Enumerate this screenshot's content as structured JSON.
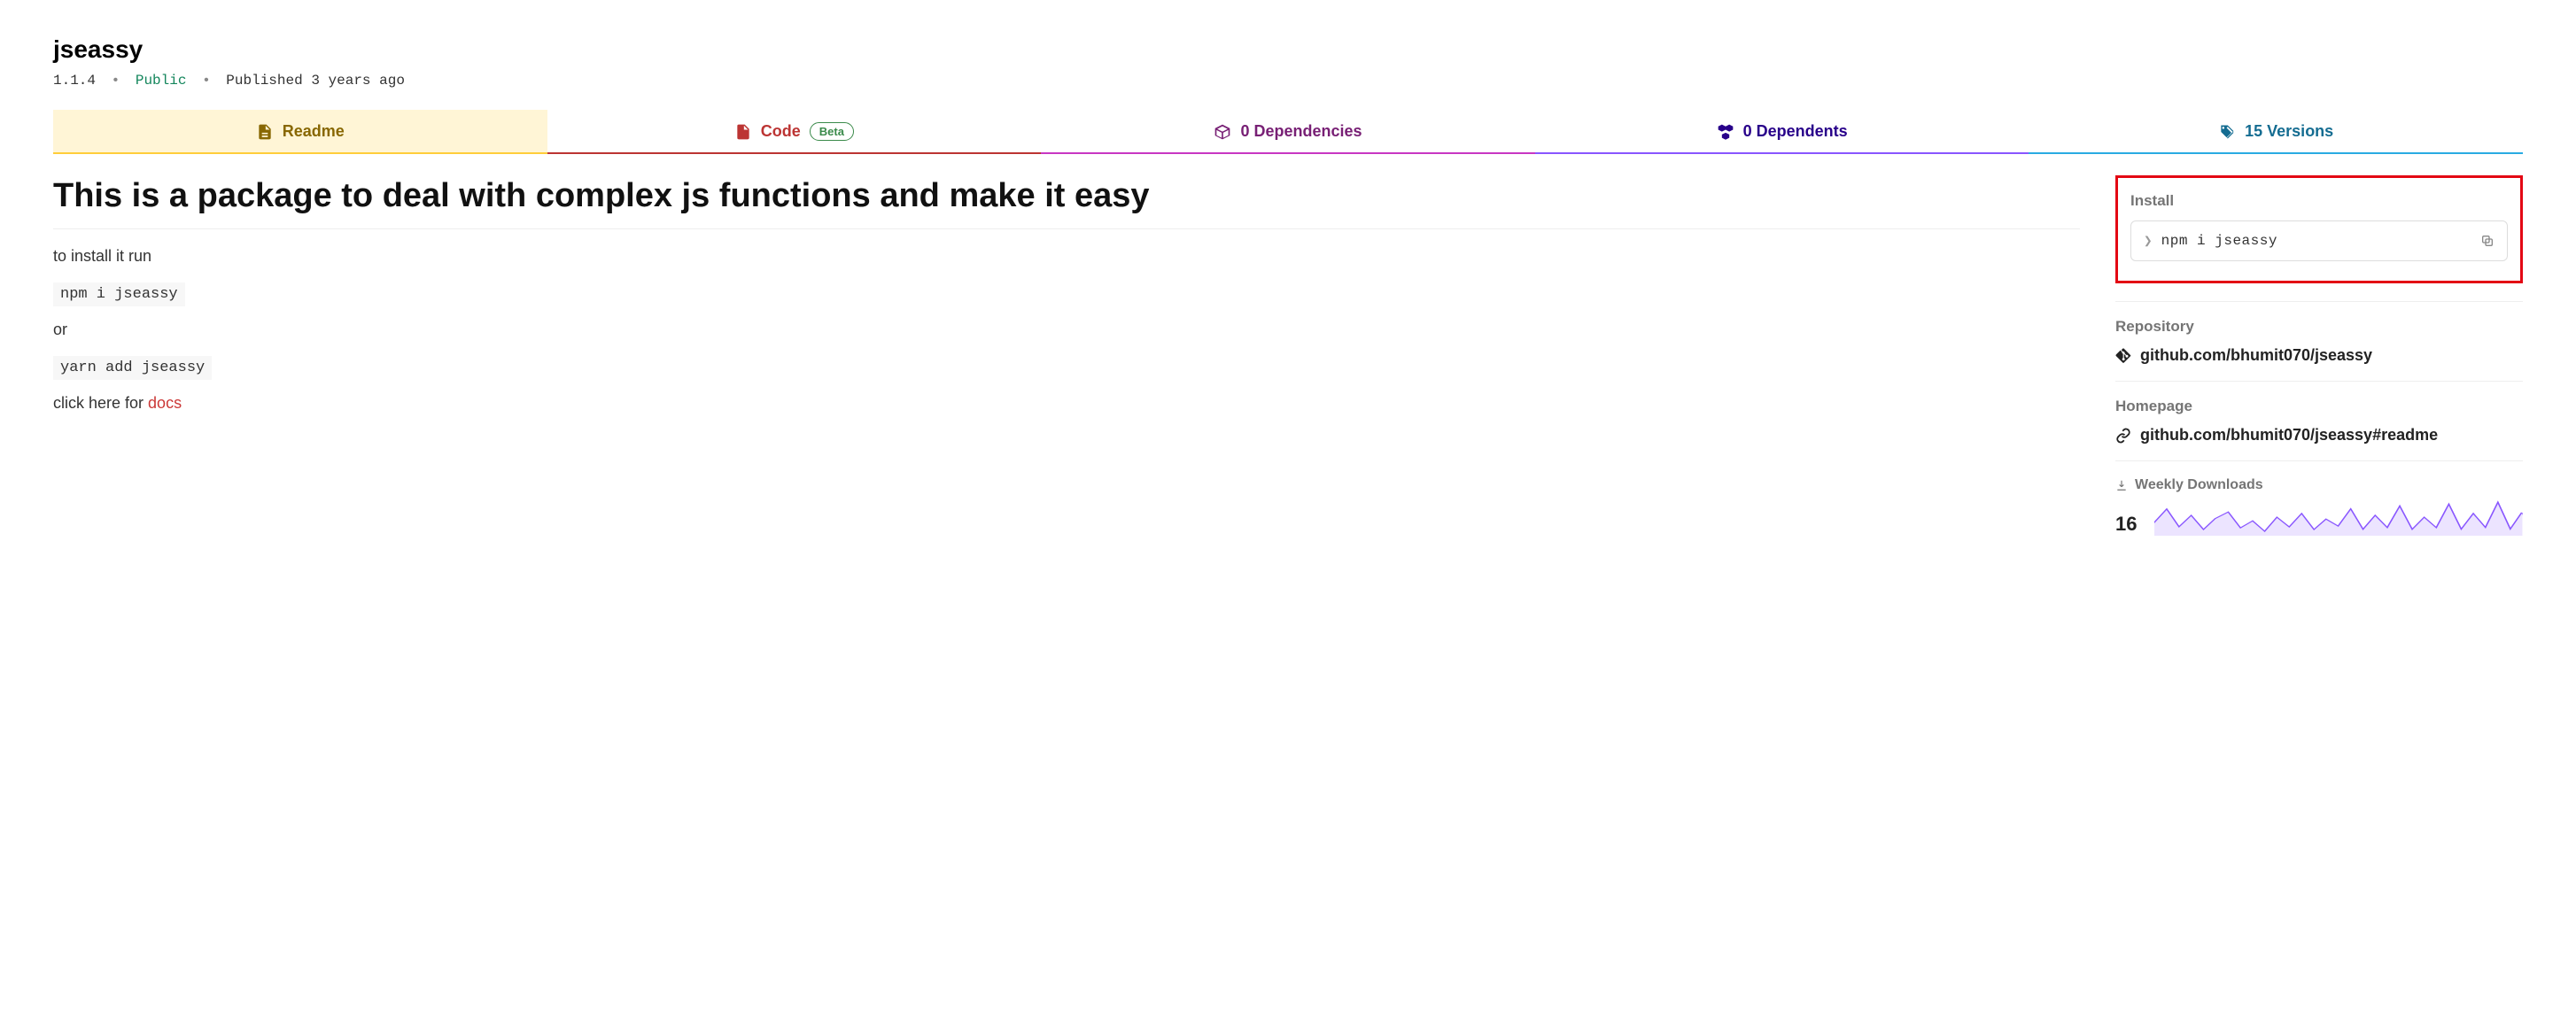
{
  "header": {
    "name": "jseassy",
    "version": "1.1.4",
    "visibility": "Public",
    "published_prefix": "Published",
    "published_time": "3 years ago"
  },
  "tabs": {
    "readme": "Readme",
    "code": "Code",
    "code_badge": "Beta",
    "deps": "0 Dependencies",
    "dependents": "0 Dependents",
    "versions": "15 Versions"
  },
  "readme": {
    "title": "This is a package to deal with complex js functions and make it easy",
    "install_intro": "to install it run",
    "install_cmd": "npm i jseassy",
    "or_text": "or",
    "yarn_cmd": "yarn add jseassy",
    "docs_prefix": "click here for ",
    "docs_link": "docs"
  },
  "sidebar": {
    "install_label": "Install",
    "install_cmd": "npm i jseassy",
    "repository_label": "Repository",
    "repository_url": "github.com/bhumit070/jseassy",
    "homepage_label": "Homepage",
    "homepage_url": "github.com/bhumit070/jseassy#readme",
    "downloads_label": "Weekly Downloads",
    "downloads_count": "16"
  }
}
